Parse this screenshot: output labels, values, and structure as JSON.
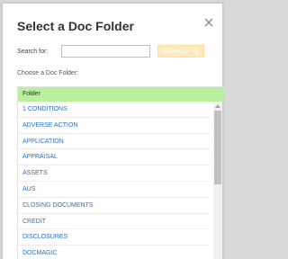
{
  "dialog": {
    "title": "Select a Doc Folder",
    "close_icon": "close-icon"
  },
  "search": {
    "label": "Search for:",
    "value": "",
    "placeholder": "",
    "button_label": "SEARCH",
    "button_icon": "search-icon"
  },
  "folder_list": {
    "prompt": "Choose a Doc Folder:",
    "header": "Folder",
    "items": [
      "1 CONDITIONS",
      "ADVERSE ACTION",
      "APPLICATION",
      "APPRAISAL",
      "ASSETS",
      "AUS",
      "CLOSING DOCUMENTS",
      "CREDIT",
      "DISCLOSURES",
      "DOCMAGIC"
    ]
  },
  "colors": {
    "header_bg": "#b8f0a0",
    "link": "#2b6fc2",
    "search_button_bg": "#fde9b9"
  }
}
